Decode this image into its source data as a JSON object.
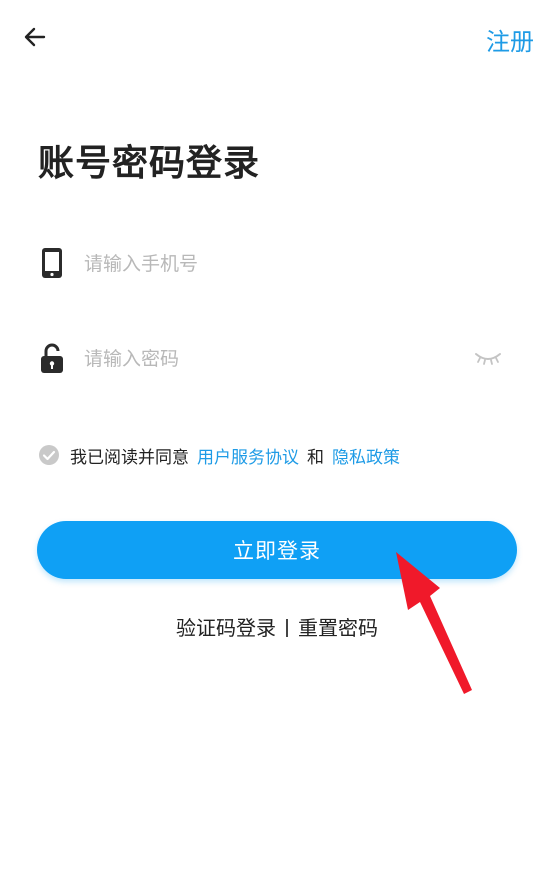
{
  "header": {
    "back_icon": "arrow-left-icon",
    "register_label": "注册"
  },
  "title": "账号密码登录",
  "phone": {
    "icon": "phone-icon",
    "placeholder": "请输入手机号",
    "value": ""
  },
  "password": {
    "icon": "lock-icon",
    "placeholder": "请输入密码",
    "value": "",
    "toggle_icon": "eye-closed-icon"
  },
  "agreement": {
    "checked": true,
    "prefix": "我已阅读并同意",
    "terms_link": "用户服务协议",
    "and": "和",
    "privacy_link": "隐私政策"
  },
  "login_button": "立即登录",
  "alt_links": {
    "sms_login": "验证码登录",
    "reset_password": "重置密码"
  },
  "colors": {
    "accent": "#1e9be6",
    "button": "#0fa0f5",
    "annotation_arrow": "#f0192a"
  }
}
